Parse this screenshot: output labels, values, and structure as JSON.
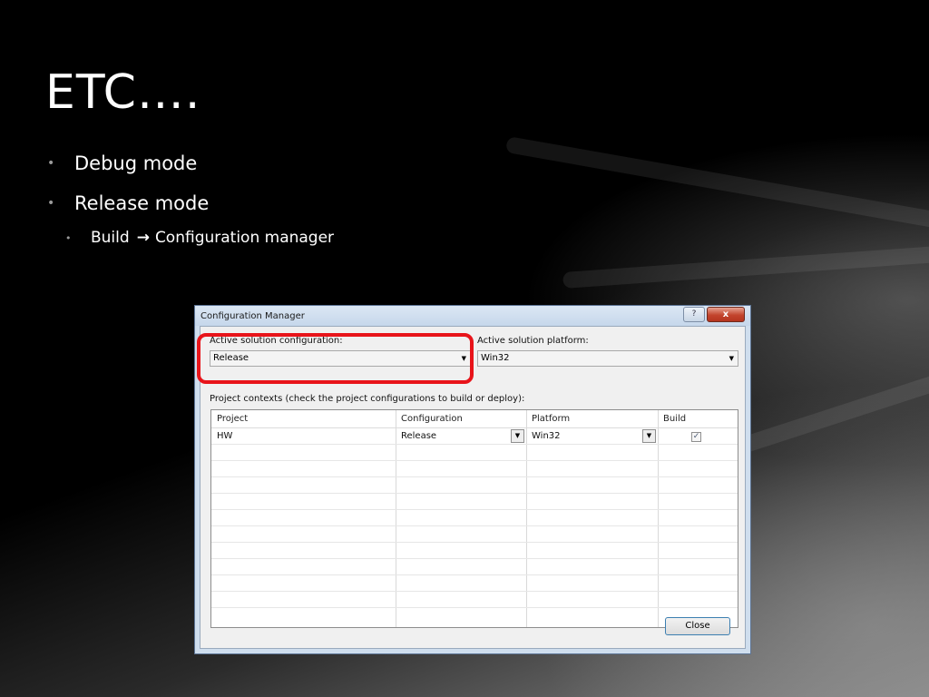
{
  "slide": {
    "title": "ETC….",
    "bullets": [
      {
        "text": "Debug mode"
      },
      {
        "text": "Release mode"
      }
    ],
    "sub_bullet": {
      "before": "Build",
      "arrow": "→",
      "after": "Configuration manager"
    }
  },
  "dialog": {
    "title": "Configuration Manager",
    "help_label": "?",
    "close_x": "x",
    "active_config_label": "Active solution configuration:",
    "active_config_value": "Release",
    "active_platform_label": "Active solution platform:",
    "active_platform_value": "Win32",
    "contexts_label": "Project contexts (check the project configurations to build or deploy):",
    "columns": [
      "Project",
      "Configuration",
      "Platform",
      "Build"
    ],
    "rows": [
      {
        "project": "HW",
        "configuration": "Release",
        "platform": "Win32",
        "build": "✓"
      }
    ],
    "close_button": "Close"
  },
  "icons": {
    "combo_arrow": "chevron-down-icon",
    "checkbox": "check-icon"
  }
}
